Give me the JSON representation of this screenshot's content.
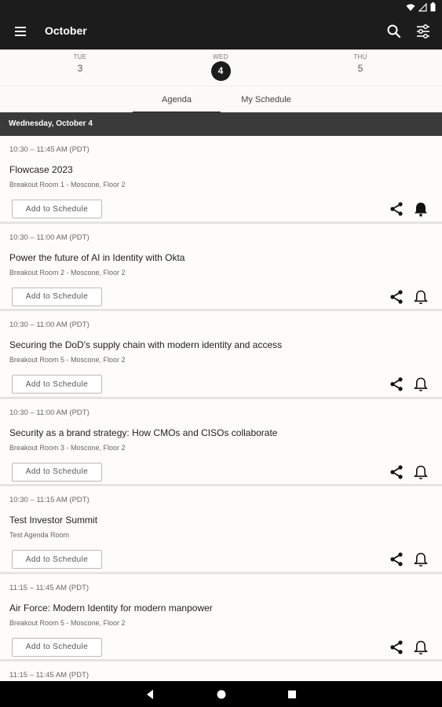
{
  "appbar": {
    "title": "October",
    "menu_icon": "hamburger-icon",
    "search_icon": "search-icon",
    "filter_icon": "sliders-icon"
  },
  "dates": [
    {
      "dow": "TUE",
      "num": "3",
      "selected": false
    },
    {
      "dow": "WED",
      "num": "4",
      "selected": true
    },
    {
      "dow": "THU",
      "num": "5",
      "selected": false
    }
  ],
  "tabs": [
    {
      "label": "Agenda",
      "active": true
    },
    {
      "label": "My Schedule",
      "active": false
    }
  ],
  "day_header": "Wednesday, October 4",
  "add_label": "Add to Schedule",
  "sessions": [
    {
      "time": "10:30 – 11:45 AM (PDT)",
      "title": "Flowcase 2023",
      "location": "Breakout Room 1 - Moscone, Floor 2",
      "reminder_on": true
    },
    {
      "time": "10:30 – 11:00 AM (PDT)",
      "title": "Power the future of AI in Identity with Okta",
      "location": "Breakout Room 2 - Moscone, Floor 2",
      "reminder_on": false
    },
    {
      "time": "10:30 – 11:00 AM (PDT)",
      "title": "Securing the DoD's supply chain with modern identity and access",
      "location": "Breakout Room 5 - Moscone, Floor 2",
      "reminder_on": false
    },
    {
      "time": "10:30 – 11:00 AM (PDT)",
      "title": "Security as a brand strategy: How CMOs and CISOs collaborate",
      "location": "Breakout Room 3 - Moscone, Floor 2",
      "reminder_on": false
    },
    {
      "time": "10:30 – 11:15 AM (PDT)",
      "title": "Test Investor Summit",
      "location": "Test Agenda Room",
      "reminder_on": false
    },
    {
      "time": "11:15 – 11:45 AM (PDT)",
      "title": "Air Force: Modern Identity for modern manpower",
      "location": "Breakout Room 5 - Moscone, Floor 2",
      "reminder_on": false
    }
  ],
  "partial_session": {
    "time": "11:15 – 11:45 AM (PDT)"
  }
}
